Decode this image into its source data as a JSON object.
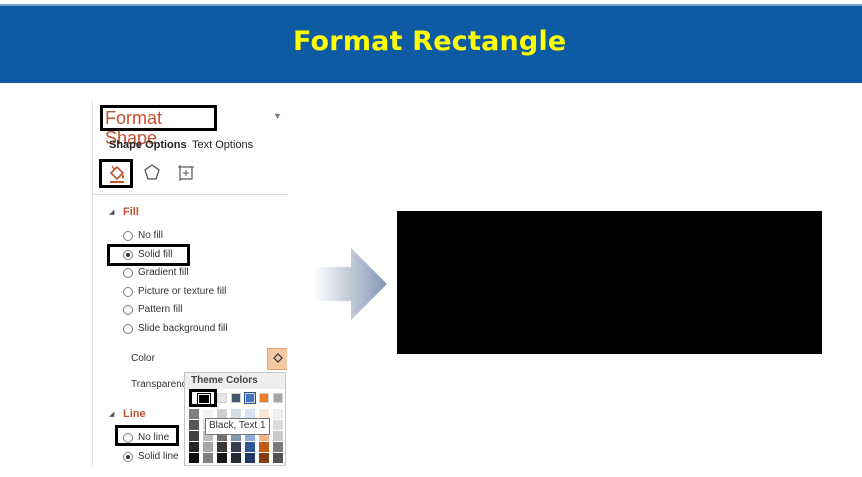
{
  "banner": {
    "title": "Format Rectangle",
    "title_color": "#ffff00",
    "background": "#0e5aa3"
  },
  "pane": {
    "title": "Format Shape",
    "tabs": [
      {
        "label": "Shape Options",
        "active": true
      },
      {
        "label": "Text Options",
        "active": false
      }
    ],
    "icon_tabs": [
      "fill-line-icon",
      "effects-icon",
      "size-properties-icon"
    ],
    "fill": {
      "heading": "Fill",
      "options": [
        {
          "label": "No fill",
          "selected": false
        },
        {
          "label": "Solid fill",
          "selected": true
        },
        {
          "label": "Gradient fill",
          "selected": false
        },
        {
          "label": "Picture or texture fill",
          "selected": false
        },
        {
          "label": "Pattern fill",
          "selected": false
        },
        {
          "label": "Slide background fill",
          "selected": false
        }
      ],
      "color_label": "Color",
      "transparency_label": "Transparenc"
    },
    "line": {
      "heading": "Line",
      "options": [
        {
          "label": "No line",
          "selected": false
        },
        {
          "label": "Solid line",
          "selected": true
        }
      ]
    }
  },
  "theme_colors": {
    "title": "Theme Colors",
    "selected_tooltip": "Black, Text 1",
    "top_row": [
      "#000000",
      "#ffffff",
      "#e7e6e6",
      "#44546a",
      "#4472c4",
      "#ed7d31",
      "#a5a5a5"
    ]
  },
  "preview": {
    "fill_color": "#000000"
  },
  "accent_color": "#c4512f"
}
